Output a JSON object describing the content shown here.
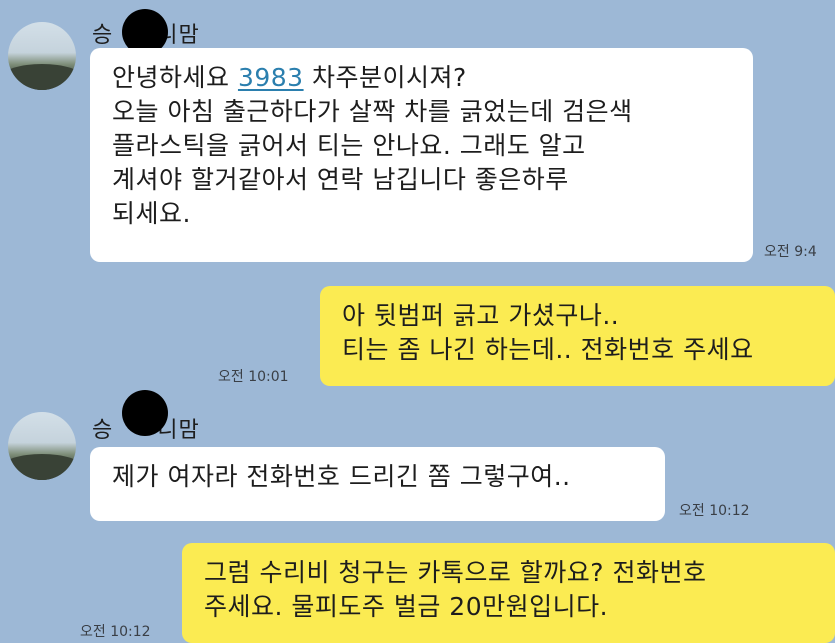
{
  "chat": {
    "sender_name_left": "승",
    "sender_name_right": "니맘",
    "messages": [
      {
        "direction": "in",
        "lines": [
          "오늘 아침 출근하다가 살짝 차를 긁었는데 검은색",
          "플라스틱을 긁어서 티는 안나요. 그래도 알고",
          "계셔야 할거같아서 연락 남깁니다 좋은하루",
          "되세요."
        ],
        "first_line_prefix": "안녕하세요 ",
        "first_line_link": "3983",
        "first_line_suffix": " 차주분이시져?",
        "time": "오전 9:4"
      },
      {
        "direction": "out",
        "lines": [
          "아 뒷범퍼 긁고 가셨구나..",
          "티는 좀 나긴 하는데.. 전화번호 주세요"
        ],
        "time": "오전 10:01"
      },
      {
        "direction": "in",
        "lines": [
          "제가 여자라 전화번호 드리긴 쫌 그렇구여.."
        ],
        "time": "오전 10:12"
      },
      {
        "direction": "out",
        "lines": [
          "그럼 수리비 청구는 카톡으로 할까요? 전화번호",
          "주세요. 물피도주 벌금 20만원입니다."
        ],
        "time": "오전 10:12"
      }
    ]
  }
}
